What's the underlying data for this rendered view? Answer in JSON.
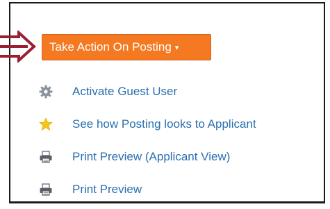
{
  "action_button": {
    "label": "Take Action On Posting",
    "caret": "▾"
  },
  "menu": {
    "items": [
      {
        "label": "Activate Guest User",
        "icon": "gear-icon"
      },
      {
        "label": "See how Posting looks to Applicant",
        "icon": "star-icon"
      },
      {
        "label": "Print Preview (Applicant View)",
        "icon": "printer-icon"
      },
      {
        "label": "Print Preview",
        "icon": "printer-icon"
      }
    ]
  },
  "colors": {
    "button_bg": "#f47920",
    "link": "#2a6fb0",
    "arrow": "#9b1f33",
    "star": "#f5c518",
    "gear": "#8a939c",
    "printer": "#5a5f66",
    "border": "#1a1a1a"
  }
}
